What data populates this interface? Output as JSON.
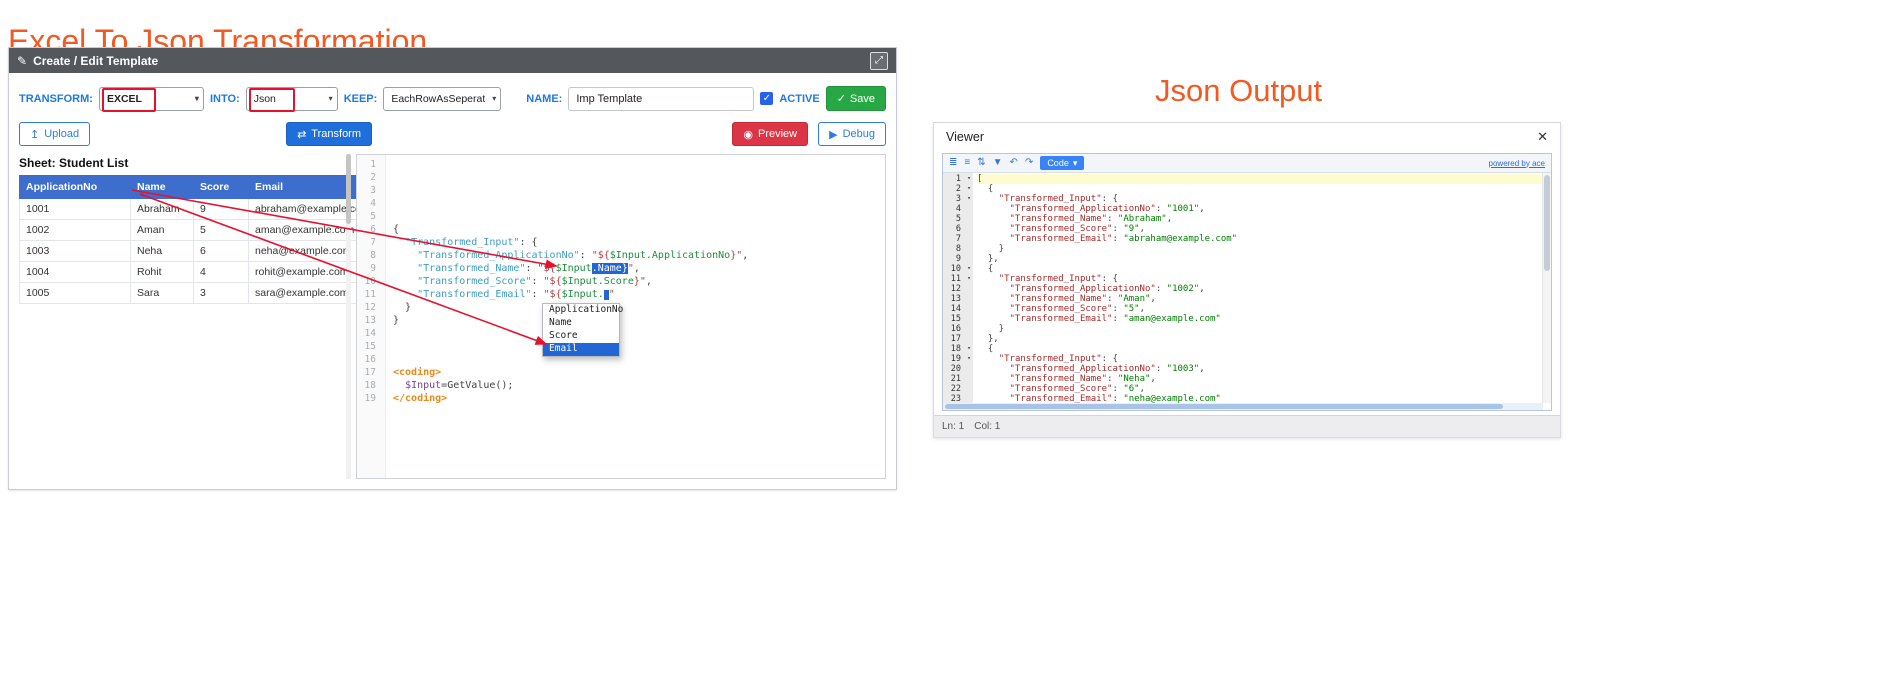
{
  "titles": {
    "left": "Excel To Json Transformation",
    "right": "Json Output"
  },
  "icons": {
    "pencil": "✎",
    "expand": "⤢",
    "caret": "▾",
    "check": "✓",
    "upload": "↥",
    "transform_arrows": "⇄",
    "eye": "◉",
    "play": "▶",
    "close": "✕",
    "fold": "▾"
  },
  "colors": {
    "accent_orange": "#F15A22",
    "annotation_red": "#E8112D",
    "panel_header_gray": "#54585C",
    "table_header_blue": "#3D6ECE",
    "primary_blue": "#1E6FD9",
    "save_green": "#28A745",
    "preview_red": "#DC3545",
    "ace_mode_button_blue": "#3883FA"
  },
  "template_panel": {
    "header": {
      "title": "Create / Edit Template"
    },
    "config": {
      "transform_label": "TRANSFORM:",
      "transform_value": "EXCEL",
      "into_label": "INTO:",
      "into_value": "Json",
      "keep_label": "KEEP:",
      "keep_value": "EachRowAsSeperateP",
      "name_label": "NAME:",
      "name_value": "Imp Template",
      "active_label": "ACTIVE",
      "save_label": "Save"
    },
    "actions": {
      "upload_label": "Upload",
      "transform_label": "Transform",
      "preview_label": "Preview",
      "debug_label": "Debug"
    },
    "sheet": {
      "title": "Sheet: Student List",
      "columns": [
        "ApplicationNo",
        "Name",
        "Score",
        "Email"
      ],
      "rows": [
        [
          "1001",
          "Abraham",
          "9",
          "abraham@example.com"
        ],
        [
          "1002",
          "Aman",
          "5",
          "aman@example.com"
        ],
        [
          "1003",
          "Neha",
          "6",
          "neha@example.com"
        ],
        [
          "1004",
          "Rohit",
          "4",
          "rohit@example.com"
        ],
        [
          "1005",
          "Sara",
          "3",
          "sara@example.com"
        ]
      ]
    },
    "code_editor": {
      "lines": [
        {
          "segs": []
        },
        {
          "segs": []
        },
        {
          "segs": []
        },
        {
          "segs": []
        },
        {
          "segs": []
        },
        {
          "segs": [
            [
              "p",
              "{"
            ]
          ]
        },
        {
          "segs": [
            [
              "p",
              "  "
            ],
            [
              "k",
              "\"Transformed_Input\""
            ],
            [
              "p",
              ": {"
            ]
          ]
        },
        {
          "segs": [
            [
              "p",
              "    "
            ],
            [
              "k",
              "\"Transformed_ApplicationNo\""
            ],
            [
              "p",
              ": "
            ],
            [
              "s",
              "\"${"
            ],
            [
              "v",
              "$Input.ApplicationNo"
            ],
            [
              "s",
              "}\""
            ],
            [
              "p",
              ","
            ]
          ]
        },
        {
          "segs": [
            [
              "p",
              "    "
            ],
            [
              "k",
              "\"Transformed_Name\""
            ],
            [
              "p",
              ": "
            ],
            [
              "s",
              "\"${"
            ],
            [
              "v",
              "$Input"
            ],
            [
              "sel",
              ".Name}"
            ],
            [
              "s",
              "\""
            ],
            [
              "p",
              ","
            ]
          ]
        },
        {
          "segs": [
            [
              "p",
              "    "
            ],
            [
              "k",
              "\"Transformed_Score\""
            ],
            [
              "p",
              ": "
            ],
            [
              "s",
              "\"${"
            ],
            [
              "v",
              "$Input.Score"
            ],
            [
              "s",
              "}\""
            ],
            [
              "p",
              ","
            ]
          ]
        },
        {
          "segs": [
            [
              "p",
              "    "
            ],
            [
              "k",
              "\"Transformed_Email\""
            ],
            [
              "p",
              ": "
            ],
            [
              "s",
              "\"${"
            ],
            [
              "v",
              "$Input."
            ],
            [
              "cur",
              " "
            ],
            [
              "s",
              "\""
            ]
          ]
        },
        {
          "segs": [
            [
              "p",
              "  }"
            ]
          ]
        },
        {
          "segs": [
            [
              "p",
              "}"
            ]
          ]
        },
        {
          "segs": []
        },
        {
          "segs": []
        },
        {
          "segs": []
        },
        {
          "segs": [
            [
              "t",
              "<coding>"
            ]
          ]
        },
        {
          "segs": [
            [
              "p",
              "  "
            ],
            [
              "v2",
              "$Input"
            ],
            [
              "p",
              "=GetValue();"
            ]
          ]
        },
        {
          "segs": [
            [
              "t",
              "</coding>"
            ]
          ]
        }
      ]
    },
    "autocomplete": {
      "items": [
        "ApplicationNo",
        "Name",
        "Score",
        "Email"
      ],
      "selected_index": 3
    }
  },
  "viewer_panel": {
    "title": "Viewer",
    "toolbar": {
      "icons": [
        {
          "name": "format-icon",
          "glyph": "≣"
        },
        {
          "name": "compact-icon",
          "glyph": "≡"
        },
        {
          "name": "sort-icon",
          "glyph": "⇅"
        },
        {
          "name": "filter-icon",
          "glyph": "▼"
        },
        {
          "name": "undo-icon",
          "glyph": "↶"
        },
        {
          "name": "redo-icon",
          "glyph": "↷"
        }
      ],
      "mode_button": "Code",
      "powered_by": "powered by ace"
    },
    "status": {
      "line": "Ln: 1",
      "col": "Col: 1"
    },
    "lines": [
      {
        "fold": true,
        "active": true,
        "segs": [
          [
            "p",
            "["
          ]
        ]
      },
      {
        "fold": true,
        "segs": [
          [
            "p",
            "  {"
          ]
        ]
      },
      {
        "fold": true,
        "segs": [
          [
            "p",
            "    "
          ],
          [
            "K",
            "\"Transformed_Input\""
          ],
          [
            "p",
            ": {"
          ]
        ]
      },
      {
        "segs": [
          [
            "p",
            "      "
          ],
          [
            "K",
            "\"Transformed_ApplicationNo\""
          ],
          [
            "p",
            ": "
          ],
          [
            "S",
            "\"1001\""
          ],
          [
            "p",
            ","
          ]
        ]
      },
      {
        "segs": [
          [
            "p",
            "      "
          ],
          [
            "K",
            "\"Transformed_Name\""
          ],
          [
            "p",
            ": "
          ],
          [
            "S",
            "\"Abraham\""
          ],
          [
            "p",
            ","
          ]
        ]
      },
      {
        "segs": [
          [
            "p",
            "      "
          ],
          [
            "K",
            "\"Transformed_Score\""
          ],
          [
            "p",
            ": "
          ],
          [
            "S",
            "\"9\""
          ],
          [
            "p",
            ","
          ]
        ]
      },
      {
        "segs": [
          [
            "p",
            "      "
          ],
          [
            "K",
            "\"Transformed_Email\""
          ],
          [
            "p",
            ": "
          ],
          [
            "S",
            "\"abraham@example.com\""
          ]
        ]
      },
      {
        "segs": [
          [
            "p",
            "    }"
          ]
        ]
      },
      {
        "segs": [
          [
            "p",
            "  },"
          ]
        ]
      },
      {
        "fold": true,
        "segs": [
          [
            "p",
            "  {"
          ]
        ]
      },
      {
        "fold": true,
        "segs": [
          [
            "p",
            "    "
          ],
          [
            "K",
            "\"Transformed_Input\""
          ],
          [
            "p",
            ": {"
          ]
        ]
      },
      {
        "segs": [
          [
            "p",
            "      "
          ],
          [
            "K",
            "\"Transformed_ApplicationNo\""
          ],
          [
            "p",
            ": "
          ],
          [
            "S",
            "\"1002\""
          ],
          [
            "p",
            ","
          ]
        ]
      },
      {
        "segs": [
          [
            "p",
            "      "
          ],
          [
            "K",
            "\"Transformed_Name\""
          ],
          [
            "p",
            ": "
          ],
          [
            "S",
            "\"Aman\""
          ],
          [
            "p",
            ","
          ]
        ]
      },
      {
        "segs": [
          [
            "p",
            "      "
          ],
          [
            "K",
            "\"Transformed_Score\""
          ],
          [
            "p",
            ": "
          ],
          [
            "S",
            "\"5\""
          ],
          [
            "p",
            ","
          ]
        ]
      },
      {
        "segs": [
          [
            "p",
            "      "
          ],
          [
            "K",
            "\"Transformed_Email\""
          ],
          [
            "p",
            ": "
          ],
          [
            "S",
            "\"aman@example.com\""
          ]
        ]
      },
      {
        "segs": [
          [
            "p",
            "    }"
          ]
        ]
      },
      {
        "segs": [
          [
            "p",
            "  },"
          ]
        ]
      },
      {
        "fold": true,
        "segs": [
          [
            "p",
            "  {"
          ]
        ]
      },
      {
        "fold": true,
        "segs": [
          [
            "p",
            "    "
          ],
          [
            "K",
            "\"Transformed_Input\""
          ],
          [
            "p",
            ": {"
          ]
        ]
      },
      {
        "segs": [
          [
            "p",
            "      "
          ],
          [
            "K",
            "\"Transformed_ApplicationNo\""
          ],
          [
            "p",
            ": "
          ],
          [
            "S",
            "\"1003\""
          ],
          [
            "p",
            ","
          ]
        ]
      },
      {
        "segs": [
          [
            "p",
            "      "
          ],
          [
            "K",
            "\"Transformed_Name\""
          ],
          [
            "p",
            ": "
          ],
          [
            "S",
            "\"Neha\""
          ],
          [
            "p",
            ","
          ]
        ]
      },
      {
        "segs": [
          [
            "p",
            "      "
          ],
          [
            "K",
            "\"Transformed_Score\""
          ],
          [
            "p",
            ": "
          ],
          [
            "S",
            "\"6\""
          ],
          [
            "p",
            ","
          ]
        ]
      },
      {
        "segs": [
          [
            "p",
            "      "
          ],
          [
            "K",
            "\"Transformed_Email\""
          ],
          [
            "p",
            ": "
          ],
          [
            "S",
            "\"neha@example.com\""
          ]
        ]
      },
      {
        "segs": [
          [
            "p",
            "    }"
          ]
        ]
      }
    ]
  }
}
